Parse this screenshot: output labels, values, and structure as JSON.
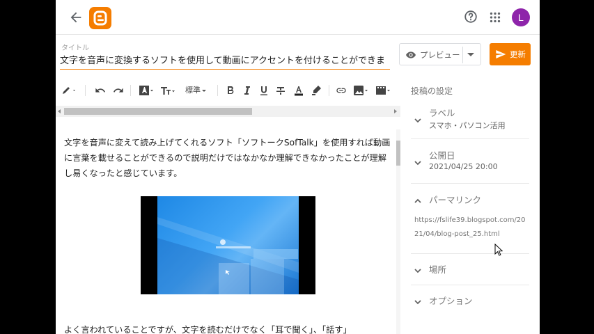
{
  "editor_title": {
    "label": "タイトル",
    "value": "文字を音声に変換するソフトを使用して動画にアクセントを付けることができま"
  },
  "header": {
    "preview_label": "プレビュー",
    "update_label": "更新",
    "avatar_letter": "L"
  },
  "toolbar": {
    "style_label": "標準"
  },
  "content": {
    "paragraph": "文字を音声に変えて読み上げてくれるソフト「ソフトークSofTalk」を使用すれば動画に言葉を載せることができるので説明だけではなかなか理解できなかったことが理解し易くなったと感じています。",
    "bottom_line": "よく言われていることですが、文字を読むだけでなく「耳で聞く」、「話す」"
  },
  "settings": {
    "title": "投稿の設定",
    "label_section": {
      "title": "ラベル",
      "value": "スマホ・パソコン活用"
    },
    "date_section": {
      "title": "公開日",
      "value": "2021/04/25 20:00"
    },
    "permalink_section": {
      "title": "パーマリンク",
      "value": "https://fslife39.blogspot.com/2021/04/blog-post_25.html"
    },
    "location_section": {
      "title": "場所"
    },
    "options_section": {
      "title": "オプション"
    }
  },
  "colors": {
    "brand": "#f57d00",
    "avatar": "#8e24aa"
  }
}
